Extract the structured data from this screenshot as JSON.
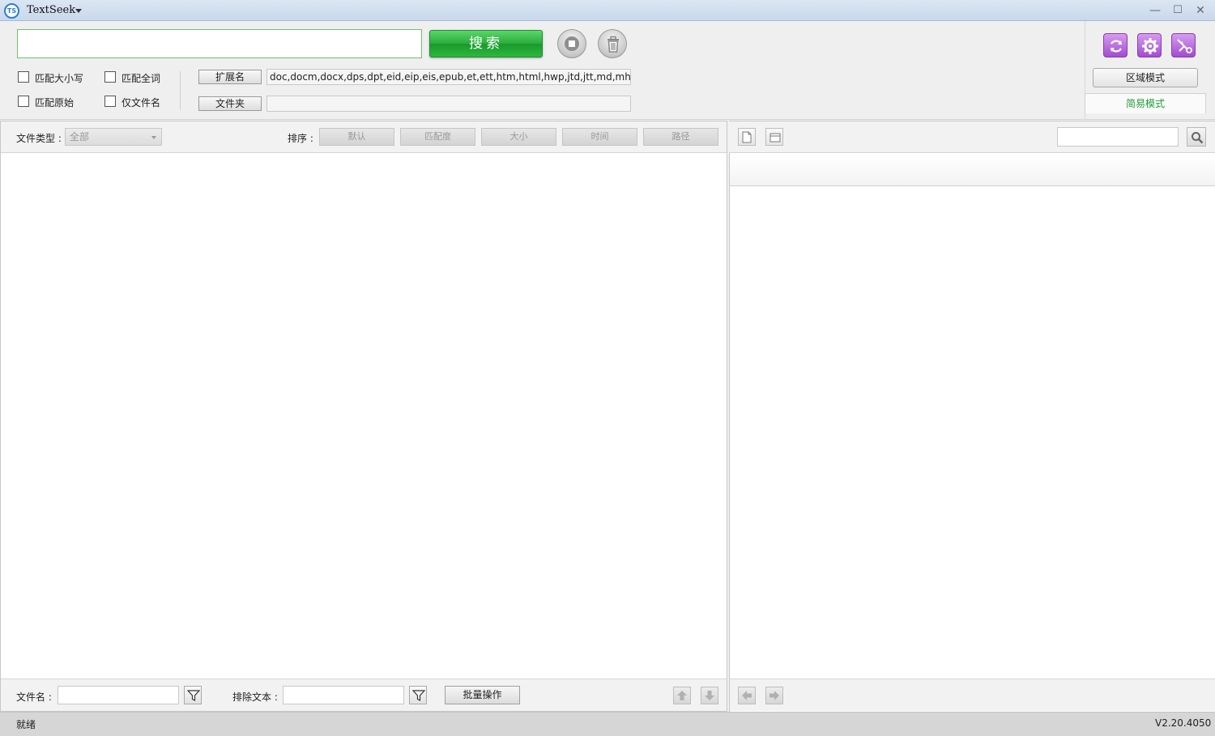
{
  "app": {
    "title": "TextSeek",
    "logo_text": "TS"
  },
  "window": {
    "minimize": "—",
    "maximize": "☐",
    "close": "✕"
  },
  "search": {
    "value": "",
    "button_label": "搜索",
    "options": {
      "match_case": "匹配大小写",
      "match_whole_word": "匹配全词",
      "match_raw": "匹配原始",
      "filename_only": "仅文件名"
    },
    "extension_button": "扩展名",
    "extensions": "doc,docm,docx,dps,dpt,eid,eip,eis,epub,et,ett,htm,html,hwp,jtd,jtt,md,mht,mhtml,odt",
    "folder_button": "文件夹",
    "folder_value": ""
  },
  "modes": {
    "area_mode": "区域模式",
    "simple_mode": "简易模式"
  },
  "results_toolbar": {
    "filetype_label": "文件类型 :",
    "filetype_value": "全部",
    "sort_label": "排序 :",
    "sort_options": [
      "默认",
      "匹配度",
      "大小",
      "时间",
      "路径"
    ]
  },
  "results_bottom": {
    "filename_label": "文件名 :",
    "exclude_label": "排除文本 :",
    "batch_button": "批量操作"
  },
  "status": {
    "text": "就绪",
    "version": "V2.20.4050"
  },
  "colors": {
    "accent_green": "#2aac3b",
    "purple": "#a24bd1",
    "simple_mode_text": "#1e9e3a"
  }
}
